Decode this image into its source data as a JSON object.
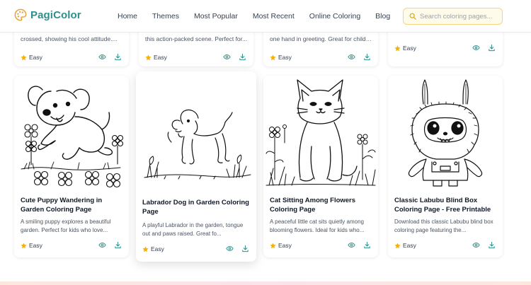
{
  "brand": {
    "name": "PagiColor",
    "accent": "#2f8f8a"
  },
  "nav": [
    {
      "label": "Home"
    },
    {
      "label": "Themes"
    },
    {
      "label": "Most Popular"
    },
    {
      "label": "Most Recent"
    },
    {
      "label": "Online Coloring"
    },
    {
      "label": "Blog"
    }
  ],
  "search": {
    "placeholder": "Search coloring pages...",
    "value": ""
  },
  "top_row": [
    {
      "desc": "crossed, showing his cool attitude....",
      "difficulty": "Easy"
    },
    {
      "desc": "this action-packed scene. Perfect for...",
      "difficulty": "Easy"
    },
    {
      "desc": "one hand in greeting. Great for childr...",
      "difficulty": "Easy"
    },
    {
      "desc": "",
      "difficulty": "Easy"
    }
  ],
  "cards": [
    {
      "title": "Cute Puppy Wandering in Garden Coloring Page",
      "desc": "A smiling puppy explores a beautiful garden. Perfect for kids who love...",
      "difficulty": "Easy",
      "image": "puppy-garden-illustration"
    },
    {
      "title": "Labrador Dog in Garden Coloring Page",
      "desc": "A playful Labrador in the garden, tongue out and paws raised. Great fo...",
      "difficulty": "Easy",
      "image": "labrador-illustration"
    },
    {
      "title": "Cat Sitting Among Flowers Coloring Page",
      "desc": "A peaceful little cat sits quietly among blooming flowers. Ideal for kids who...",
      "difficulty": "Easy",
      "image": "cat-flowers-illustration"
    },
    {
      "title": "Classic Labubu Blind Box Coloring Page - Free Printable",
      "desc": "Download this classic Labubu blind box coloring page featuring the...",
      "difficulty": "Easy",
      "image": "labubu-illustration"
    }
  ],
  "icons": {
    "star": "star-icon",
    "view": "eye-icon",
    "download": "download-icon",
    "search": "search-icon"
  },
  "colors": {
    "star": "#f5b301",
    "icon": "#2f8f8a",
    "search_border": "#f3d67b"
  }
}
